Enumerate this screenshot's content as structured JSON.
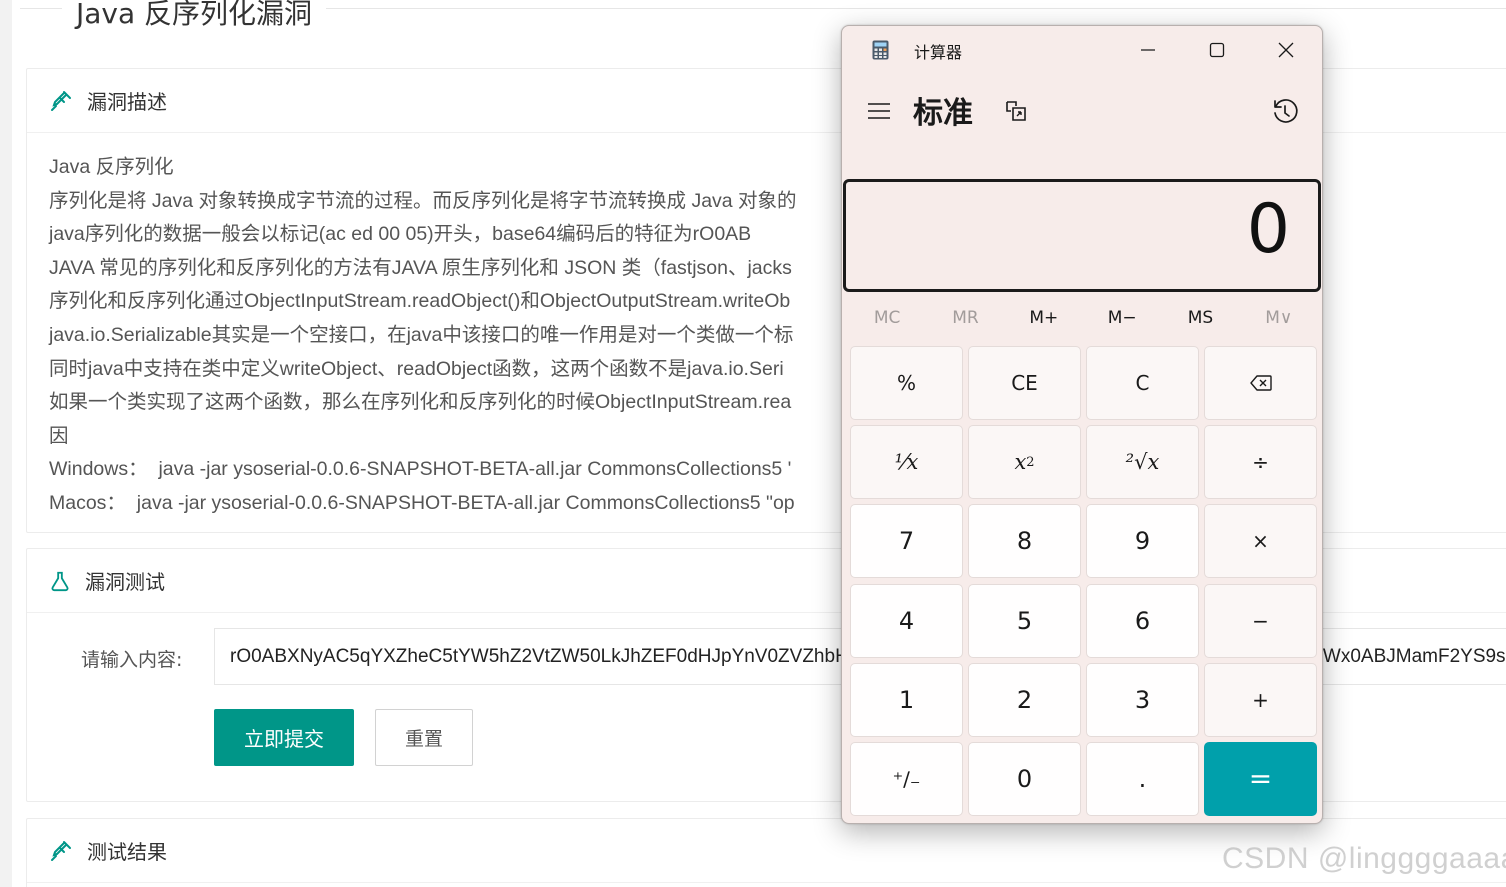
{
  "page": {
    "title": "Java 反序列化漏洞",
    "desc_section": {
      "heading": "漏洞描述",
      "lines": [
        "Java 反序列化",
        "序列化是将 Java 对象转换成字节流的过程。而反序列化是将字节流转换成 Java 对象的",
        "java序列化的数据一般会以标记(ac ed 00 05)开头，base64编码后的特征为rO0AB",
        "JAVA 常见的序列化和反序列化的方法有JAVA 原生序列化和 JSON 类（fastjson、jacks",
        "序列化和反序列化通过ObjectInputStream.readObject()和ObjectOutputStream.writeOb                              须实现java.io.Serializ",
        "java.io.Serializable其实是一个空接口，在java中该接口的唯一作用是对一个类做一个标",
        "同时java中支持在类中定义writeObject、readObject函数，这两个函数不是java.io.Seri",
        "如果一个类实现了这两个函数，那么在序列化和反序列化的时候ObjectInputStream.rea                              动调用这两个函数。",
        "因",
        "Windows：  java -jar ysoserial-0.0.6-SNAPSHOT-BETA-all.jar CommonsCollections5 '",
        "Macos：  java -jar ysoserial-0.0.6-SNAPSHOT-BETA-all.jar CommonsCollections5 \"op"
      ]
    },
    "test_section": {
      "heading": "漏洞测试",
      "label": "请输入内容:",
      "input_value": "rO0ABXNyAC5qYXZheC5tYW5hZ2VtZW50LkJhZEF0dHJpYnV0ZVZhbHVlRXhwRXhjZXB0aW9uAAAAAAAAAAECAAFMAAN2YWx0ABJMamF2YS9sYW5nL09iamVjdDt4cgATamF2YS5sYW5nLkV4Y2VwdGlvbgAAAAAAAAFMAAN2YWx0ABJMFMAAN2YWx0ABJM",
      "submit": "立即提交",
      "reset": "重置"
    },
    "result_section": {
      "heading": "测试结果"
    },
    "watermark": "CSDN @linggggaaaa",
    "accent_color": "#009688"
  },
  "calculator": {
    "window_title": "计算器",
    "mode": "标准",
    "display": "0",
    "memory": [
      "MC",
      "MR",
      "M+",
      "M−",
      "MS",
      "M∨"
    ],
    "memory_disabled": [
      true,
      true,
      false,
      false,
      false,
      true
    ],
    "keys": {
      "percent": "%",
      "ce": "CE",
      "c": "C",
      "backspace": "⌫",
      "reciprocal": "⅟x",
      "square": "x",
      "sqrt": "²√x",
      "divide": "÷",
      "seven": "7",
      "eight": "8",
      "nine": "9",
      "multiply": "×",
      "four": "4",
      "five": "5",
      "six": "6",
      "minus": "−",
      "one": "1",
      "two": "2",
      "three": "3",
      "plus": "+",
      "negate": "⁺∕₋",
      "zero": "0",
      "decimal": ".",
      "equals": "="
    },
    "equals_color": "#00a0ab"
  }
}
